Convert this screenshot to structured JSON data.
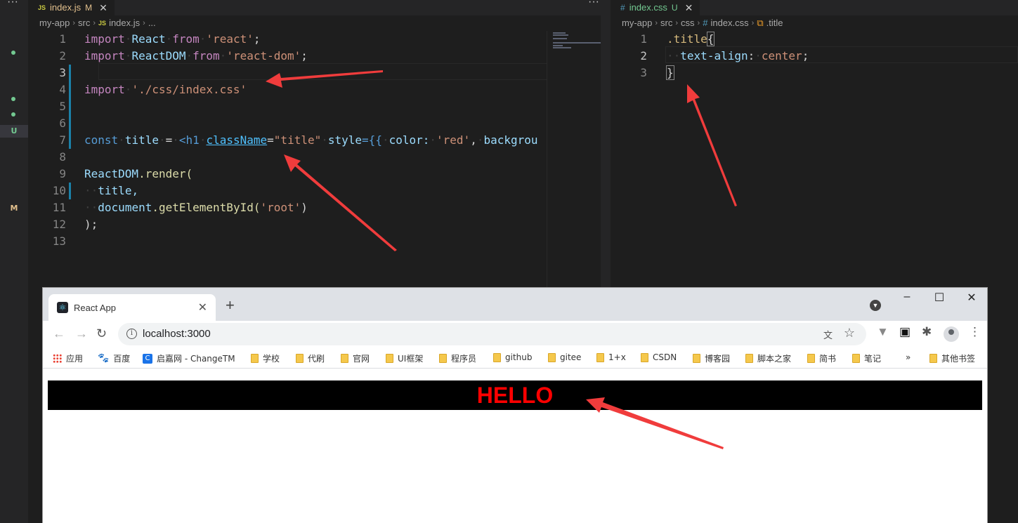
{
  "editor_left": {
    "tab": {
      "icon": "JS",
      "name": "index.js",
      "badge": "M"
    },
    "breadcrumb": [
      "my-app",
      "src",
      "JS",
      "index.js",
      "..."
    ],
    "lines": [
      "1",
      "2",
      "3",
      "4",
      "5",
      "6",
      "7",
      "8",
      "9",
      "10",
      "11",
      "12",
      "13"
    ]
  },
  "editor_right": {
    "tab": {
      "icon": "#",
      "name": "index.css",
      "badge": "U"
    },
    "breadcrumb": [
      "my-app",
      "src",
      "css",
      "#",
      "index.css",
      ".title"
    ],
    "lines": [
      "1",
      "2",
      "3"
    ]
  },
  "activity": {
    "git_u": "U",
    "git_m": "M"
  },
  "code_js": {
    "l1": [
      "import",
      "React",
      "from",
      "'react'",
      ";"
    ],
    "l2": [
      "import",
      "ReactDOM",
      "from",
      "'react-dom'",
      ";"
    ],
    "l4": [
      "import",
      "'./css/index.css'"
    ],
    "l7": [
      "const",
      "title",
      "=",
      "<h1",
      "className",
      "=",
      "\"title\"",
      "style",
      "={{",
      "color:",
      "'red'",
      ",",
      "backgrou"
    ],
    "l9": [
      "ReactDOM",
      ".render("
    ],
    "l10": [
      "title,"
    ],
    "l11": [
      "document",
      ".getElementById(",
      "'root'",
      ")"
    ],
    "l12": [
      ");"
    ]
  },
  "code_css": {
    "l1": [
      ".title",
      "{"
    ],
    "l2": [
      "text-align",
      ":",
      "center",
      ";"
    ],
    "l3": [
      "}"
    ]
  },
  "browser": {
    "tab_title": "React App",
    "url": "localhost:3000",
    "bookmarks": [
      "应用",
      "百度",
      "启嘉网 - ChangeTM",
      "学校",
      "代刷",
      "官网",
      "UI框架",
      "程序员",
      "github",
      "gitee",
      "1+x",
      "CSDN",
      "博客园",
      "脚本之家",
      "简书",
      "笔记",
      "»",
      "其他书签"
    ],
    "page_heading": "HELLO",
    "heading_color": "#ff0000",
    "heading_bg": "#000000"
  },
  "annotation_color": "#f03c3c"
}
